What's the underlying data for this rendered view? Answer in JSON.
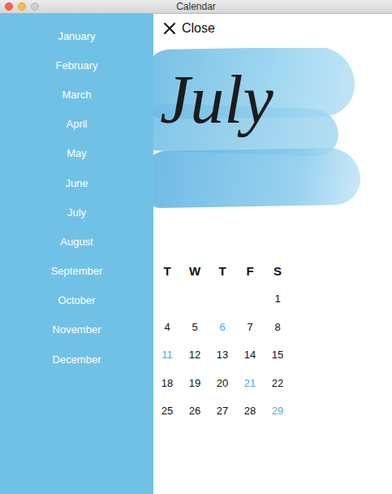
{
  "window": {
    "title": "Calendar"
  },
  "sidebar": {
    "items": [
      {
        "label": "January"
      },
      {
        "label": "February"
      },
      {
        "label": "March"
      },
      {
        "label": "April"
      },
      {
        "label": "May"
      },
      {
        "label": "June"
      },
      {
        "label": "July"
      },
      {
        "label": "August"
      },
      {
        "label": "September"
      },
      {
        "label": "October"
      },
      {
        "label": "November"
      },
      {
        "label": "December"
      }
    ]
  },
  "close_button": {
    "label": "Close"
  },
  "banner": {
    "title": "July"
  },
  "calendar": {
    "weekdays": [
      "T",
      "W",
      "T",
      "F",
      "S"
    ],
    "weeks": [
      [
        {
          "day": "",
          "highlighted": false
        },
        {
          "day": "",
          "highlighted": false
        },
        {
          "day": "",
          "highlighted": false
        },
        {
          "day": "",
          "highlighted": false
        },
        {
          "day": "1",
          "highlighted": false
        }
      ],
      [
        {
          "day": "4",
          "highlighted": false
        },
        {
          "day": "5",
          "highlighted": false
        },
        {
          "day": "6",
          "highlighted": true
        },
        {
          "day": "7",
          "highlighted": false
        },
        {
          "day": "8",
          "highlighted": false
        }
      ],
      [
        {
          "day": "11",
          "highlighted": true
        },
        {
          "day": "12",
          "highlighted": false
        },
        {
          "day": "13",
          "highlighted": false
        },
        {
          "day": "14",
          "highlighted": false
        },
        {
          "day": "15",
          "highlighted": false
        }
      ],
      [
        {
          "day": "18",
          "highlighted": false
        },
        {
          "day": "19",
          "highlighted": false
        },
        {
          "day": "20",
          "highlighted": false
        },
        {
          "day": "21",
          "highlighted": true
        },
        {
          "day": "22",
          "highlighted": false
        }
      ],
      [
        {
          "day": "25",
          "highlighted": false
        },
        {
          "day": "26",
          "highlighted": false
        },
        {
          "day": "27",
          "highlighted": false
        },
        {
          "day": "28",
          "highlighted": false
        },
        {
          "day": "29",
          "highlighted": true
        }
      ]
    ]
  }
}
